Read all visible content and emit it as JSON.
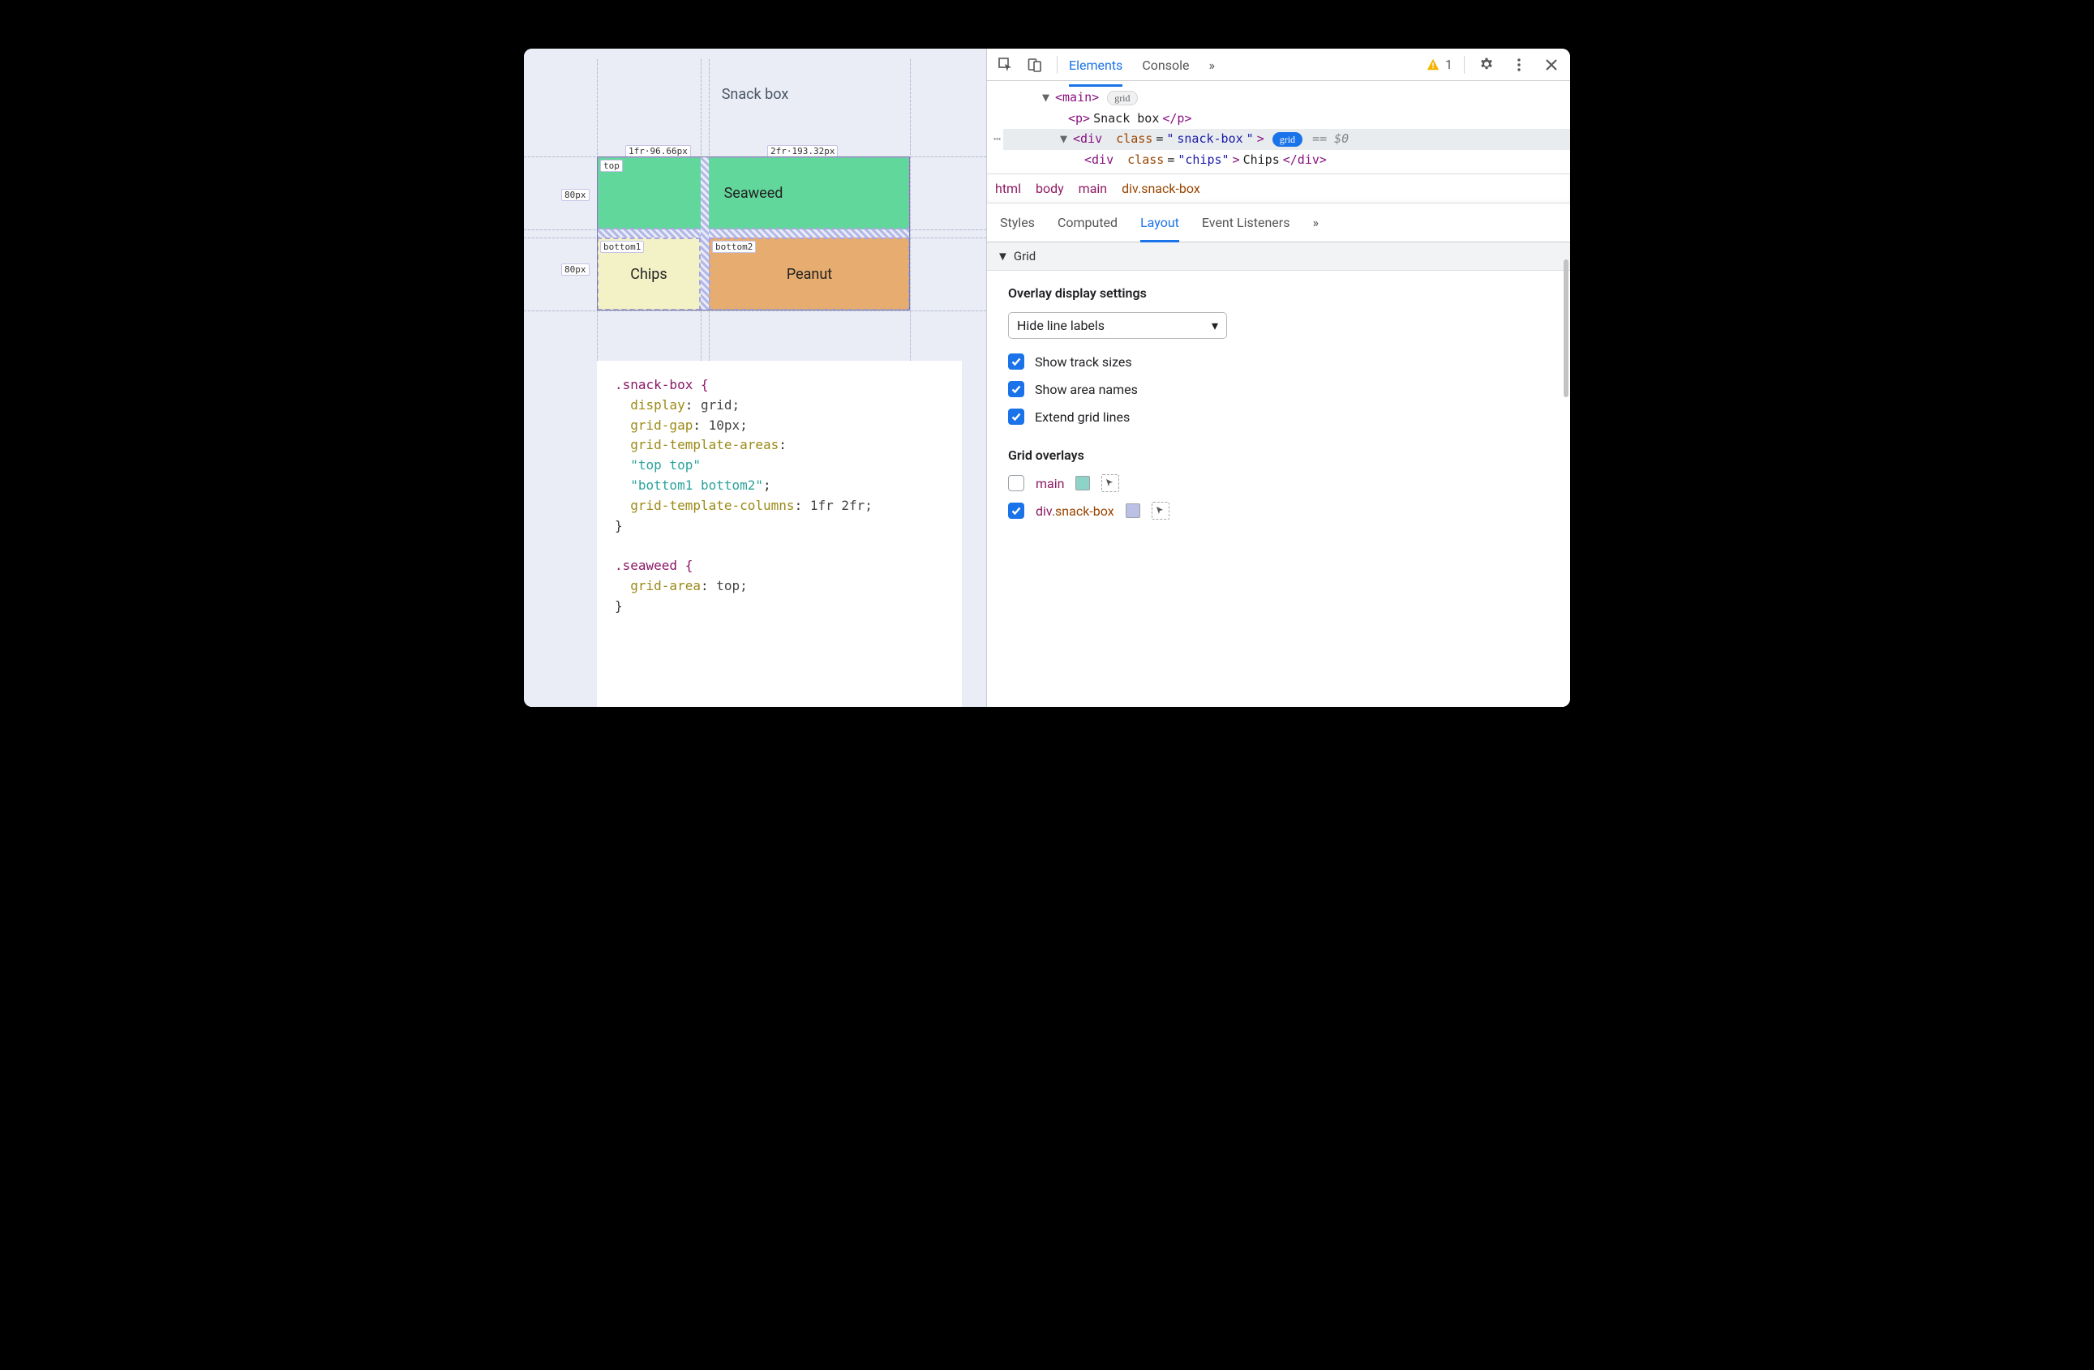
{
  "preview": {
    "title": "Snack box",
    "areas": {
      "top": {
        "name": "top",
        "content": "Seaweed"
      },
      "bottom1": {
        "name": "bottom1",
        "content": "Chips"
      },
      "bottom2": {
        "name": "bottom2",
        "content": "Peanut"
      }
    },
    "tracks": {
      "col1": "1fr·96.66px",
      "col2": "2fr·193.32px",
      "row1": "80px",
      "row2": "80px"
    }
  },
  "code": {
    "sel1": ".snack-box {",
    "p_display": "display",
    "v_display": "grid;",
    "p_gap": "grid-gap",
    "v_gap": "10px;",
    "p_areas": "grid-template-areas",
    "s_areas1": "\"top top\"",
    "s_areas2": "\"bottom1 bottom2\"",
    "p_cols": "grid-template-columns",
    "v_cols": "1fr 2fr;",
    "sel2": ".seaweed {",
    "p_area": "grid-area",
    "v_area": "top;",
    "brace": "}"
  },
  "toolbar": {
    "tabs": {
      "elements": "Elements",
      "console": "Console"
    },
    "warning_count": "1"
  },
  "dom": {
    "main_open": "<main>",
    "main_badge": "grid",
    "p_line": "<p>Snack box</p>",
    "snackbox_open": "<div class=\"snack-box\">",
    "snackbox_badge": "grid",
    "snackbox_eq": "== $0",
    "chips_line": "<div class=\"chips\">Chips</div>"
  },
  "breadcrumbs": {
    "html": "html",
    "body": "body",
    "main": "main",
    "snack": "div.snack-box"
  },
  "subtabs": {
    "styles": "Styles",
    "computed": "Computed",
    "layout": "Layout",
    "listeners": "Event Listeners"
  },
  "layout": {
    "section": "Grid",
    "overlay_settings_title": "Overlay display settings",
    "line_labels_select": "Hide line labels",
    "opt_track_sizes": "Show track sizes",
    "opt_area_names": "Show area names",
    "opt_extend_lines": "Extend grid lines",
    "overlays_title": "Grid overlays",
    "overlay_main": "main",
    "overlay_snack": "div.snack-box",
    "swatch_main": "#8dd3c7",
    "swatch_snack": "#bcc0e6"
  }
}
